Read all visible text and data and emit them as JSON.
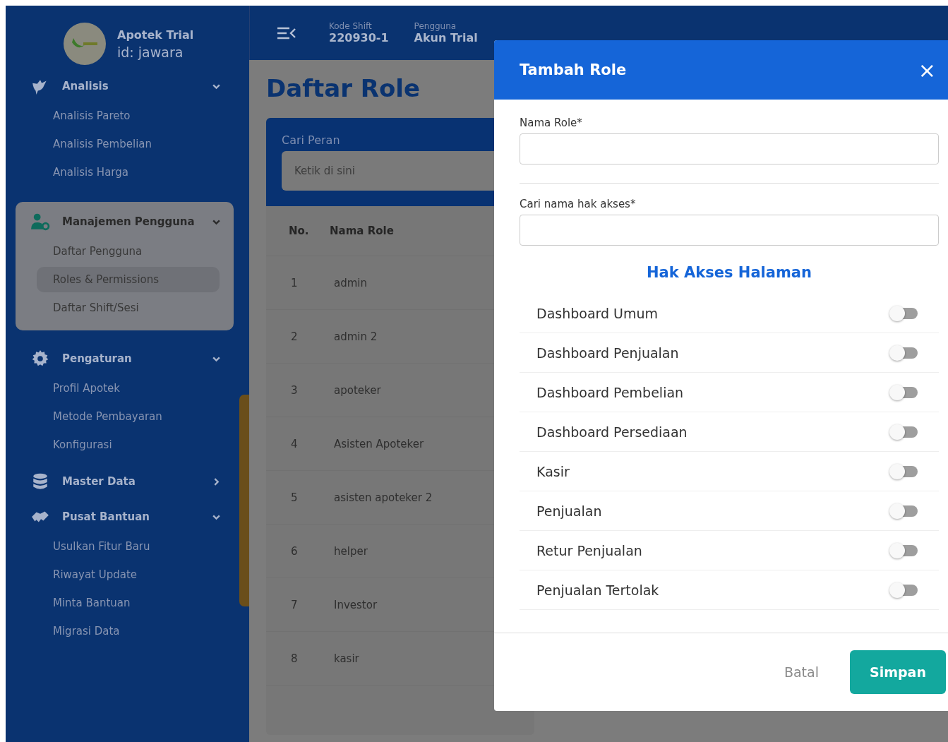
{
  "sidebar": {
    "brand": {
      "name": "Apotek Trial",
      "id": "id: jawara"
    },
    "groups": [
      {
        "label": "Analisis",
        "kind": "bird",
        "expanded": true,
        "active": false,
        "items": [
          {
            "label": "Analisis Pareto",
            "selected": false
          },
          {
            "label": "Analisis Pembelian",
            "selected": false
          },
          {
            "label": "Analisis Harga",
            "selected": false
          }
        ]
      },
      {
        "label": "Manajemen Pengguna",
        "kind": "user-gear",
        "expanded": true,
        "active": true,
        "items": [
          {
            "label": "Daftar Pengguna",
            "selected": false
          },
          {
            "label": "Roles & Permissions",
            "selected": true
          },
          {
            "label": "Daftar Shift/Sesi",
            "selected": false
          }
        ]
      },
      {
        "label": "Pengaturan",
        "kind": "gear",
        "expanded": true,
        "active": false,
        "items": [
          {
            "label": "Profil Apotek",
            "selected": false
          },
          {
            "label": "Metode Pembayaran",
            "selected": false
          },
          {
            "label": "Konfigurasi",
            "selected": false
          }
        ]
      },
      {
        "label": "Master Data",
        "kind": "database",
        "expanded": false,
        "active": false
      },
      {
        "label": "Pusat Bantuan",
        "kind": "handshake",
        "expanded": true,
        "active": false,
        "items": [
          {
            "label": "Usulkan Fitur Baru",
            "selected": false
          },
          {
            "label": "Riwayat Update",
            "selected": false
          },
          {
            "label": "Minta Bantuan",
            "selected": false
          },
          {
            "label": "Migrasi Data",
            "selected": false
          }
        ]
      }
    ]
  },
  "header": {
    "fields": [
      {
        "label": "Kode Shift",
        "value": "220930-1"
      },
      {
        "label": "Pengguna",
        "value": "Akun Trial"
      }
    ]
  },
  "page": {
    "title": "Daftar Role",
    "search": {
      "label": "Cari Peran",
      "placeholder": "Ketik di sini"
    },
    "table": {
      "columns": [
        "No.",
        "Nama Role"
      ],
      "rows": [
        [
          "1",
          "admin"
        ],
        [
          "2",
          "admin 2"
        ],
        [
          "3",
          "apoteker"
        ],
        [
          "4",
          "Asisten Apoteker"
        ],
        [
          "5",
          "asisten apoteker 2"
        ],
        [
          "6",
          "helper"
        ],
        [
          "7",
          "Investor"
        ],
        [
          "8",
          "kasir"
        ]
      ]
    }
  },
  "modal": {
    "title": "Tambah Role",
    "close": "×",
    "fields": [
      {
        "label": "Nama Role*"
      },
      {
        "label": "Cari nama hak akses*"
      }
    ],
    "section_title": "Hak Akses Halaman",
    "permissions": [
      {
        "label": "Dashboard Umum",
        "on": false
      },
      {
        "label": "Dashboard Penjualan",
        "on": false
      },
      {
        "label": "Dashboard Pembelian",
        "on": false
      },
      {
        "label": "Dashboard Persediaan",
        "on": false
      },
      {
        "label": "Kasir",
        "on": false
      },
      {
        "label": "Penjualan",
        "on": false
      },
      {
        "label": "Retur Penjualan",
        "on": false
      },
      {
        "label": "Penjualan Tertolak",
        "on": false
      }
    ],
    "buttons": {
      "cancel": "Batal",
      "save": "Simpan"
    }
  }
}
